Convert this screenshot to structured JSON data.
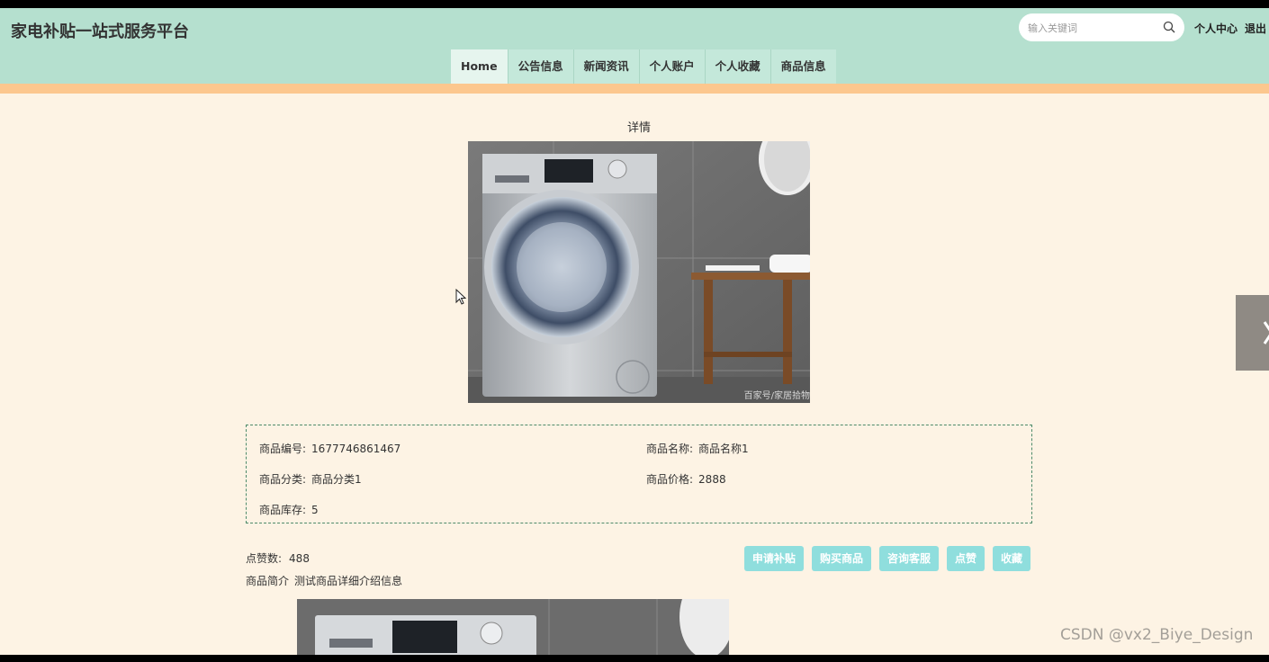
{
  "header": {
    "title": "家电补贴一站式服务平台",
    "search_placeholder": "输入关键词",
    "user_center": "个人中心",
    "logout": "退出"
  },
  "nav": [
    "Home",
    "公告信息",
    "新闻资讯",
    "个人账户",
    "个人收藏",
    "商品信息"
  ],
  "detail": {
    "heading": "详情",
    "image_watermark": "百家号/家居拾物",
    "fields": {
      "id_label": "商品编号:",
      "id_value": "1677746861467",
      "name_label": "商品名称:",
      "name_value": "商品名称1",
      "category_label": "商品分类:",
      "category_value": "商品分类1",
      "price_label": "商品价格:",
      "price_value": "2888",
      "stock_label": "商品库存:",
      "stock_value": "5"
    },
    "likes_label": "点赞数:",
    "likes_value": "488",
    "intro_label": "商品简介",
    "intro_value": "测试商品详细介绍信息",
    "actions": [
      "申请补贴",
      "购买商品",
      "咨询客服",
      "点赞",
      "收藏"
    ]
  },
  "watermark": "CSDN @vx2_Biye_Design",
  "colors": {
    "header_bg": "#b5e0cf",
    "stripe": "#fcc78e",
    "page_bg": "#fdf3e4",
    "button_bg": "#8fdedd"
  }
}
